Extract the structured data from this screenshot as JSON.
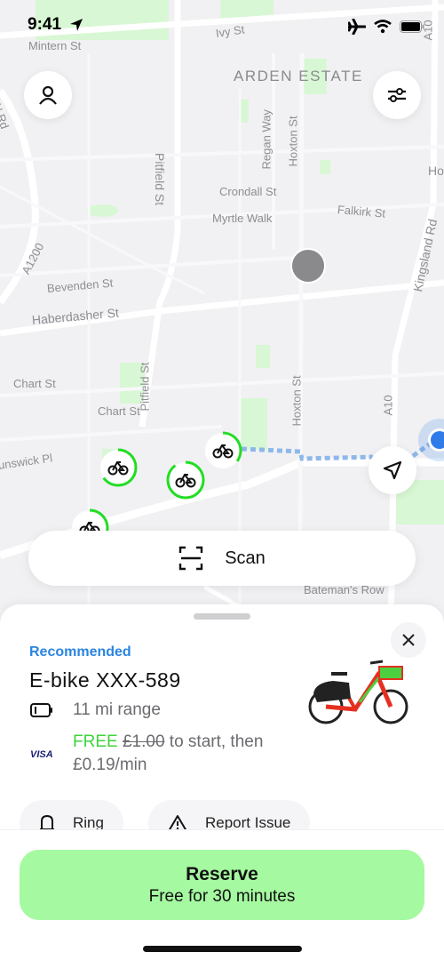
{
  "status_bar": {
    "time": "9:41",
    "icons": [
      "location-arrow-icon",
      "airplane-icon",
      "wifi-icon",
      "battery-icon"
    ]
  },
  "map": {
    "streets": [
      {
        "name": "Mintern St"
      },
      {
        "name": "Ivy St"
      },
      {
        "name": "ARDEN ESTATE"
      },
      {
        "name": "Regan Way"
      },
      {
        "name": "Hoxton St"
      },
      {
        "name": "Pitfield St"
      },
      {
        "name": "Crondall St"
      },
      {
        "name": "Myrtle Walk"
      },
      {
        "name": "Falkirk St"
      },
      {
        "name": "Kingsland Rd"
      },
      {
        "name": "A1200"
      },
      {
        "name": "Bevenden St"
      },
      {
        "name": "Haberdasher St"
      },
      {
        "name": "Chart St"
      },
      {
        "name": "Chart St"
      },
      {
        "name": "Pitfield St"
      },
      {
        "name": "Hoxton St"
      },
      {
        "name": "A10"
      },
      {
        "name": "unswick Pl"
      },
      {
        "name": "Bateman's Row"
      },
      {
        "name": "A10"
      },
      {
        "name": "Ho"
      },
      {
        "name": "ew N Rd"
      }
    ],
    "bike_markers": [
      {
        "battery": 0.65
      },
      {
        "battery": 0.9
      },
      {
        "battery": 0.35
      },
      {
        "battery": 0.3
      }
    ],
    "profile_button": "person-icon",
    "filter_button": "sliders-icon",
    "recenter_button": "navigation-arrow-icon"
  },
  "scan_button": {
    "label": "Scan",
    "icon": "scan-frame-icon"
  },
  "sheet": {
    "tag": "Recommended",
    "bike_name": "E-bike XXX-589",
    "range": "11 mi range",
    "payment_brand": "VISA",
    "price_free": "FREE",
    "price_strike": "£1.00",
    "price_rest": " to start, then £0.19/min",
    "actions": [
      {
        "label": "Ring",
        "icon": "bell-icon"
      },
      {
        "label": "Report Issue",
        "icon": "warning-icon"
      }
    ]
  },
  "reserve": {
    "title": "Reserve",
    "subtitle": "Free for 30 minutes"
  },
  "colors": {
    "accent_green": "#3fd43b",
    "reserve_bg": "#a5f9a0",
    "recommended_blue": "#2b84e0",
    "user_location_blue": "#2f7bea"
  }
}
